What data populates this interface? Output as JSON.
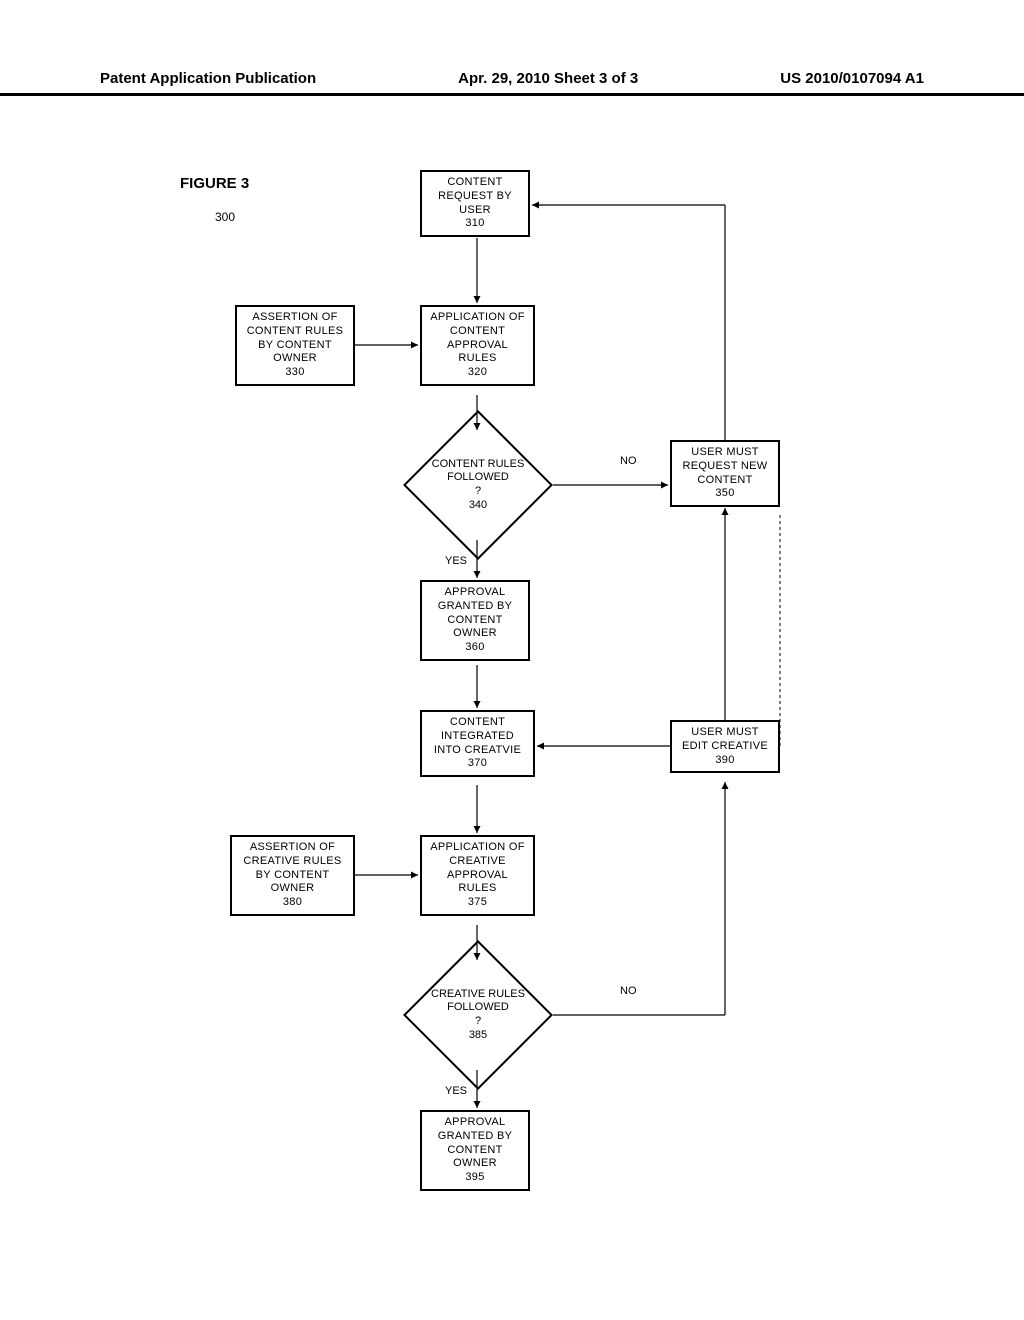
{
  "header": {
    "left": "Patent Application Publication",
    "center": "Apr. 29, 2010  Sheet 3 of 3",
    "right": "US 2010/0107094 A1"
  },
  "figure": {
    "label": "FIGURE 3",
    "num": "300"
  },
  "boxes": {
    "b310": "CONTENT REQUEST BY USER\n310",
    "b330": "ASSERTION OF CONTENT RULES BY CONTENT OWNER\n330",
    "b320": "APPLICATION OF CONTENT APPROVAL RULES\n320",
    "b350": "USER MUST REQUEST NEW CONTENT\n350",
    "b360": "APPROVAL GRANTED BY CONTENT OWNER\n360",
    "b370": "CONTENT INTEGRATED INTO CREATVIE\n370",
    "b390": "USER MUST EDIT CREATIVE\n390",
    "b380": "ASSERTION OF CREATIVE RULES BY CONTENT OWNER\n380",
    "b375": "APPLICATION OF CREATIVE APPROVAL RULES\n375",
    "b395": "APPROVAL GRANTED BY CONTENT OWNER\n395"
  },
  "diamonds": {
    "d340": "CONTENT RULES FOLLOWED\n?\n340",
    "d385": "CREATIVE RULES FOLLOWED\n?\n385"
  },
  "labels": {
    "no1": "NO",
    "yes1": "YES",
    "no2": "NO",
    "yes2": "YES"
  }
}
